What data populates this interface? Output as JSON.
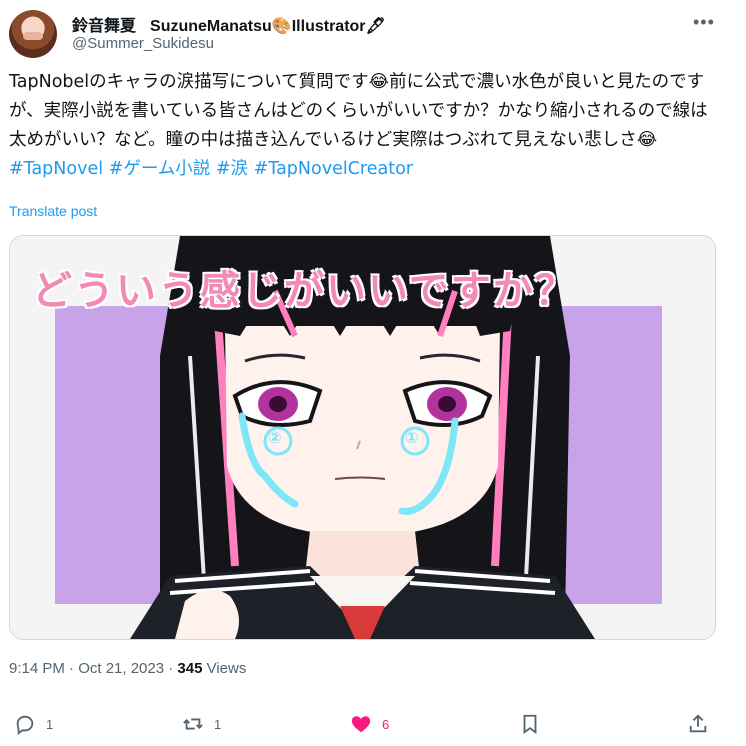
{
  "author": {
    "display_name": "鈴音舞夏",
    "alt_name": "SuzuneManatsu🎨Illustrator🖋",
    "handle": "@Summer_Sukidesu"
  },
  "tweet": {
    "text_main": "TapNobelのキャラの涙描写について質問です😂前に公式で濃い水色が良いと見たのですが、実際小説を書いている皆さんはどのくらいがいいですか？かなり縮小されるので線は太めがいい？など。瞳の中は描き込んでいるけど実際はつぶれて見えない悲しさ😂 ",
    "tags": [
      "#TapNovel",
      "#ゲーム小説",
      "#涙",
      "#TapNovelCreator"
    ],
    "translate": "Translate post"
  },
  "media": {
    "caption": "どういう感じがいいですか？",
    "tear_marks": [
      "②",
      "①"
    ]
  },
  "meta": {
    "time": "9:14 PM · Oct 21, 2023 · ",
    "views_count": "345",
    "views_label": " Views"
  },
  "actions": {
    "reply_count": "1",
    "repost_count": "1",
    "like_count": "6"
  },
  "colors": {
    "accent": "#1d9bf0",
    "like": "#f91880",
    "muted": "#536471",
    "purple_bg": "#c9a3ea"
  }
}
